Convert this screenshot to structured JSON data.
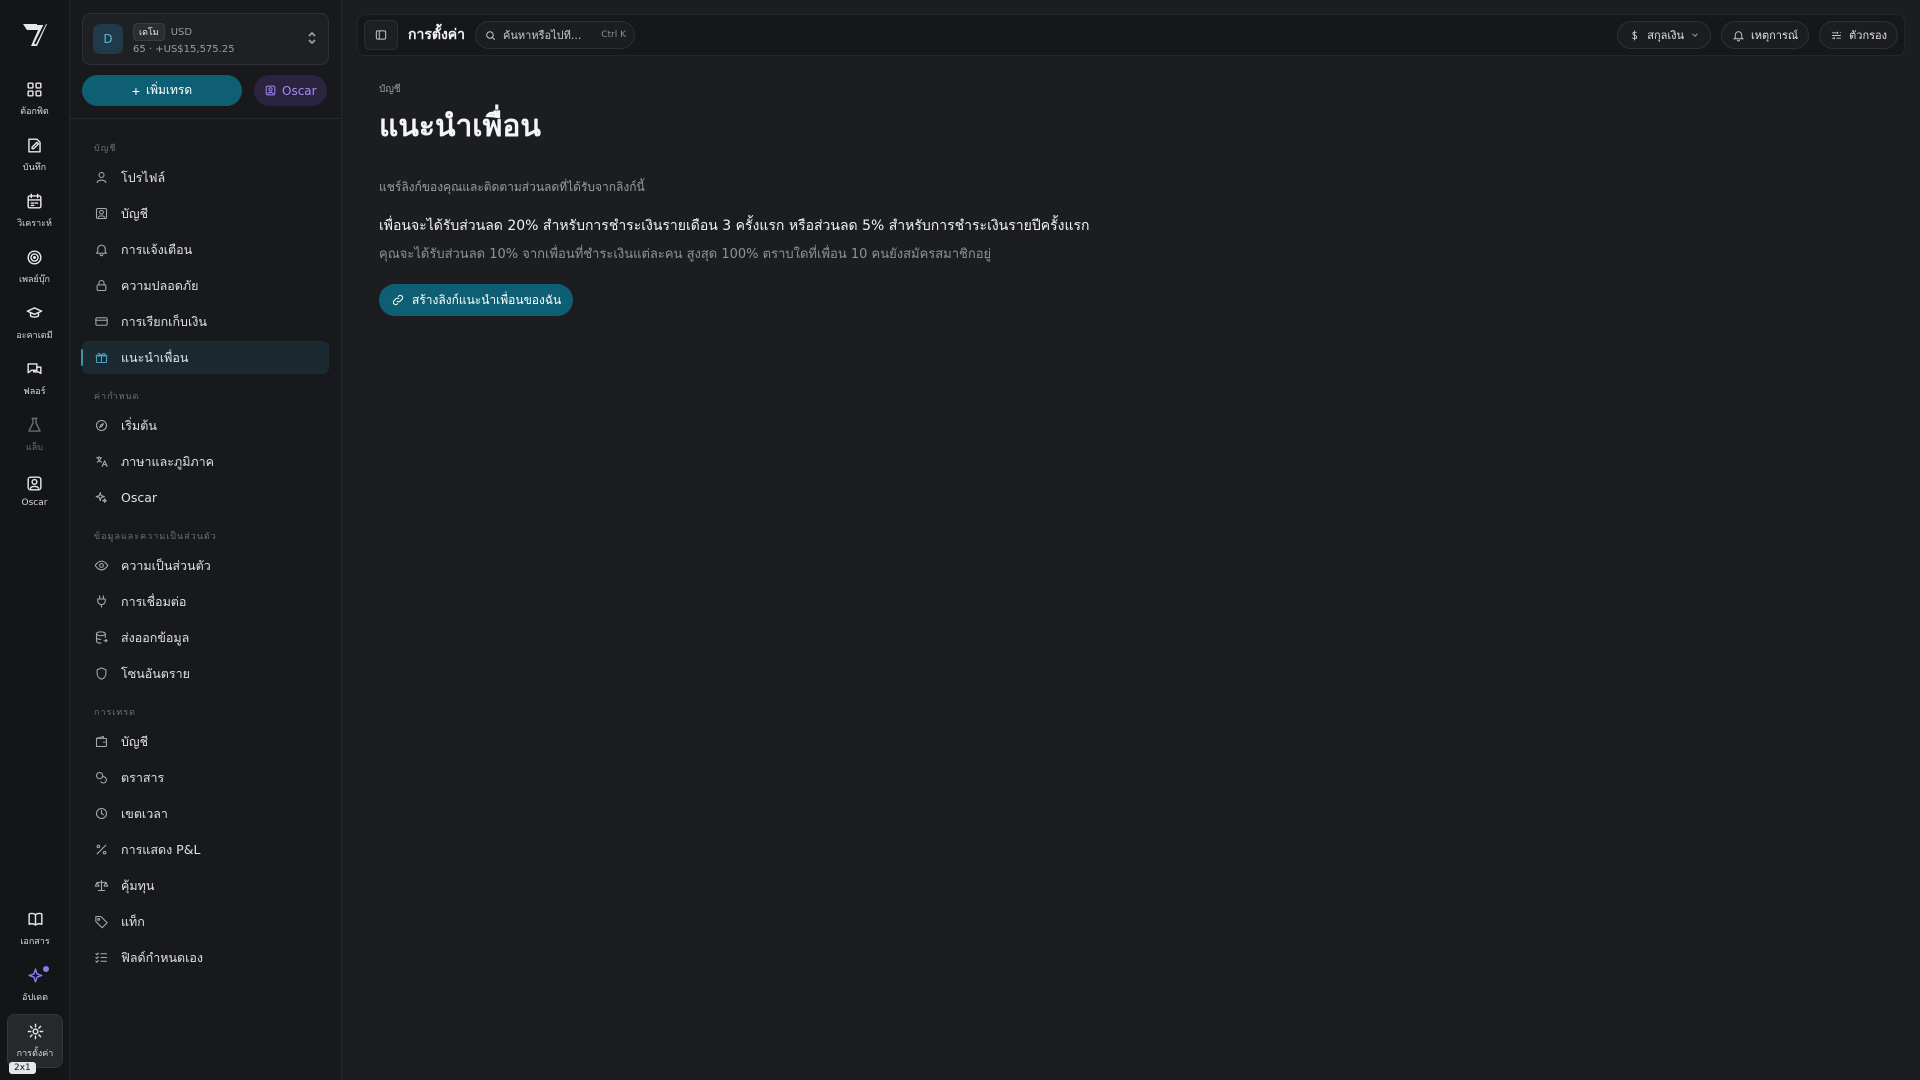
{
  "rail": {
    "items": [
      {
        "label": "ต้อกพิต",
        "icon": "dashboard-icon"
      },
      {
        "label": "บันทึก",
        "icon": "journal-icon"
      },
      {
        "label": "วิเคราะห์",
        "icon": "calendar-icon"
      },
      {
        "label": "เพลย์บุ๊ก",
        "icon": "target-icon"
      },
      {
        "label": "อะคาเดมี",
        "icon": "graduation-cap-icon"
      },
      {
        "label": "ฟลอร์",
        "icon": "chat-icon"
      },
      {
        "label": "แล็บ",
        "icon": "flask-icon"
      },
      {
        "label": "Oscar",
        "icon": "oscar-icon"
      }
    ],
    "bottom": [
      {
        "label": "เอกสาร",
        "icon": "book-icon"
      },
      {
        "label": "อัปเดต",
        "icon": "sparkle-icon"
      },
      {
        "label": "การตั้งค่า",
        "icon": "gear-icon"
      }
    ],
    "zoom_badge": "2x1"
  },
  "account": {
    "avatar": "D",
    "tag": "เดโม",
    "currency": "USD",
    "balance": "65 · +US$15,575.25"
  },
  "sidebar": {
    "add_trade": "เพิ่มเทรด",
    "oscar": "Oscar",
    "sections": [
      {
        "title": "บัญชี",
        "items": [
          "โปรไฟล์",
          "บัญชี",
          "การแจ้งเตือน",
          "ความปลอดภัย",
          "การเรียกเก็บเงิน",
          "แนะนำเพื่อน"
        ]
      },
      {
        "title": "ค่ากำหนด",
        "items": [
          "เริ่มต้น",
          "ภาษาและภูมิภาค",
          "Oscar"
        ]
      },
      {
        "title": "ข้อมูลและความเป็นส่วนตัว",
        "items": [
          "ความเป็นส่วนตัว",
          "การเชื่อมต่อ",
          "ส่งออกข้อมูล",
          "โซนอันตราย"
        ]
      },
      {
        "title": "การเทรด",
        "items": [
          "บัญชี",
          "ตราสาร",
          "เขตเวลา",
          "การแสดง P&L",
          "คุ้มทุน",
          "แท็ก",
          "ฟิลด์กำหนดเอง"
        ]
      }
    ]
  },
  "topbar": {
    "title": "การตั้งค่า",
    "search_placeholder": "ค้นหาหรือไปที่...",
    "shortcut": "Ctrl K",
    "currency": "สกุลเงิน",
    "events": "เหตุการณ์",
    "filters": "ตัวกรอง"
  },
  "main": {
    "eyebrow": "บัญชี",
    "title": "แนะนำเพื่อน",
    "description": "แชร์ลิงก์ของคุณและติดตามส่วนลดที่ได้รับจากลิงก์นี้",
    "offer": "เพื่อนจะได้รับส่วนลด 20% สำหรับการชำระเงินรายเดือน 3 ครั้งแรก หรือส่วนลด 5% สำหรับการชำระเงินรายปีครั้งแรก",
    "offer_sub": "คุณจะได้รับส่วนลด 10% จากเพื่อนที่ชำระเงินแต่ละคน สูงสุด 100% ตราบใดที่เพื่อน 10 คนยังสมัครสมาชิกอยู่",
    "create_link": "สร้างลิงก์แนะนำเพื่อนของฉัน"
  },
  "colors": {
    "accent": "#0f5f74",
    "oscar": "#a98bf2",
    "background": "#1c1d20"
  }
}
